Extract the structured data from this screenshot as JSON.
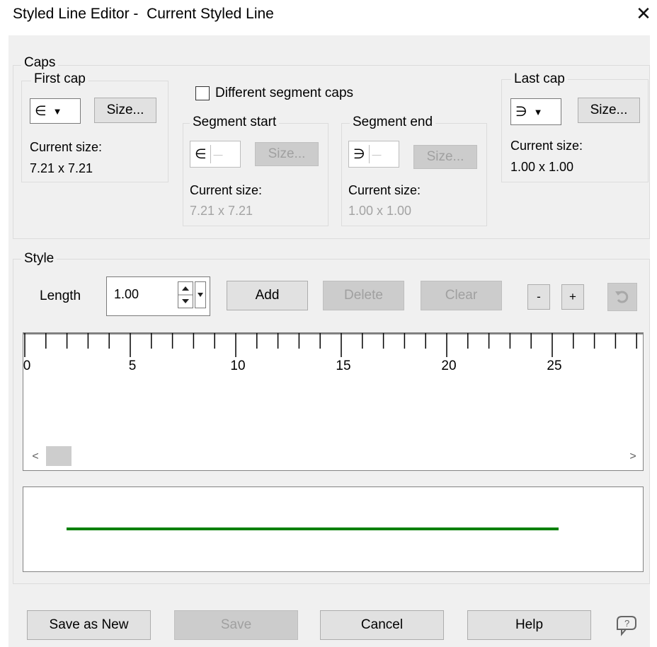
{
  "window": {
    "title": "Styled Line Editor -  Current Styled Line",
    "close_glyph": "✕"
  },
  "caps": {
    "group_label": "Caps",
    "first_cap": {
      "label": "First cap",
      "glyph": "∈",
      "size_button": "Size...",
      "current_size_label": "Current size:",
      "current_size_value": "7.21 x 7.21"
    },
    "different_segment_caps": {
      "label": "Different segment caps",
      "checked": false
    },
    "segment_start": {
      "label": "Segment start",
      "glyph": "∈",
      "size_button": "Size...",
      "current_size_label": "Current size:",
      "current_size_value": "7.21 x 7.21"
    },
    "segment_end": {
      "label": "Segment end",
      "glyph": "∋",
      "size_button": "Size...",
      "current_size_label": "Current size:",
      "current_size_value": "1.00 x 1.00"
    },
    "last_cap": {
      "label": "Last cap",
      "glyph": "∋",
      "size_button": "Size...",
      "current_size_label": "Current size:",
      "current_size_value": "1.00 x 1.00"
    }
  },
  "style": {
    "group_label": "Style",
    "length_label": "Length",
    "length_value": "1.00",
    "add_button": "Add",
    "delete_button": "Delete",
    "clear_button": "Clear",
    "minus_button": "-",
    "plus_button": "+",
    "ruler_labels": [
      "0",
      "5",
      "10",
      "15",
      "20",
      "25"
    ],
    "scroll_left": "<",
    "scroll_right": ">",
    "preview_line_color": "#008000"
  },
  "buttons": {
    "save_as_new": "Save as New",
    "save": "Save",
    "cancel": "Cancel",
    "help": "Help"
  }
}
